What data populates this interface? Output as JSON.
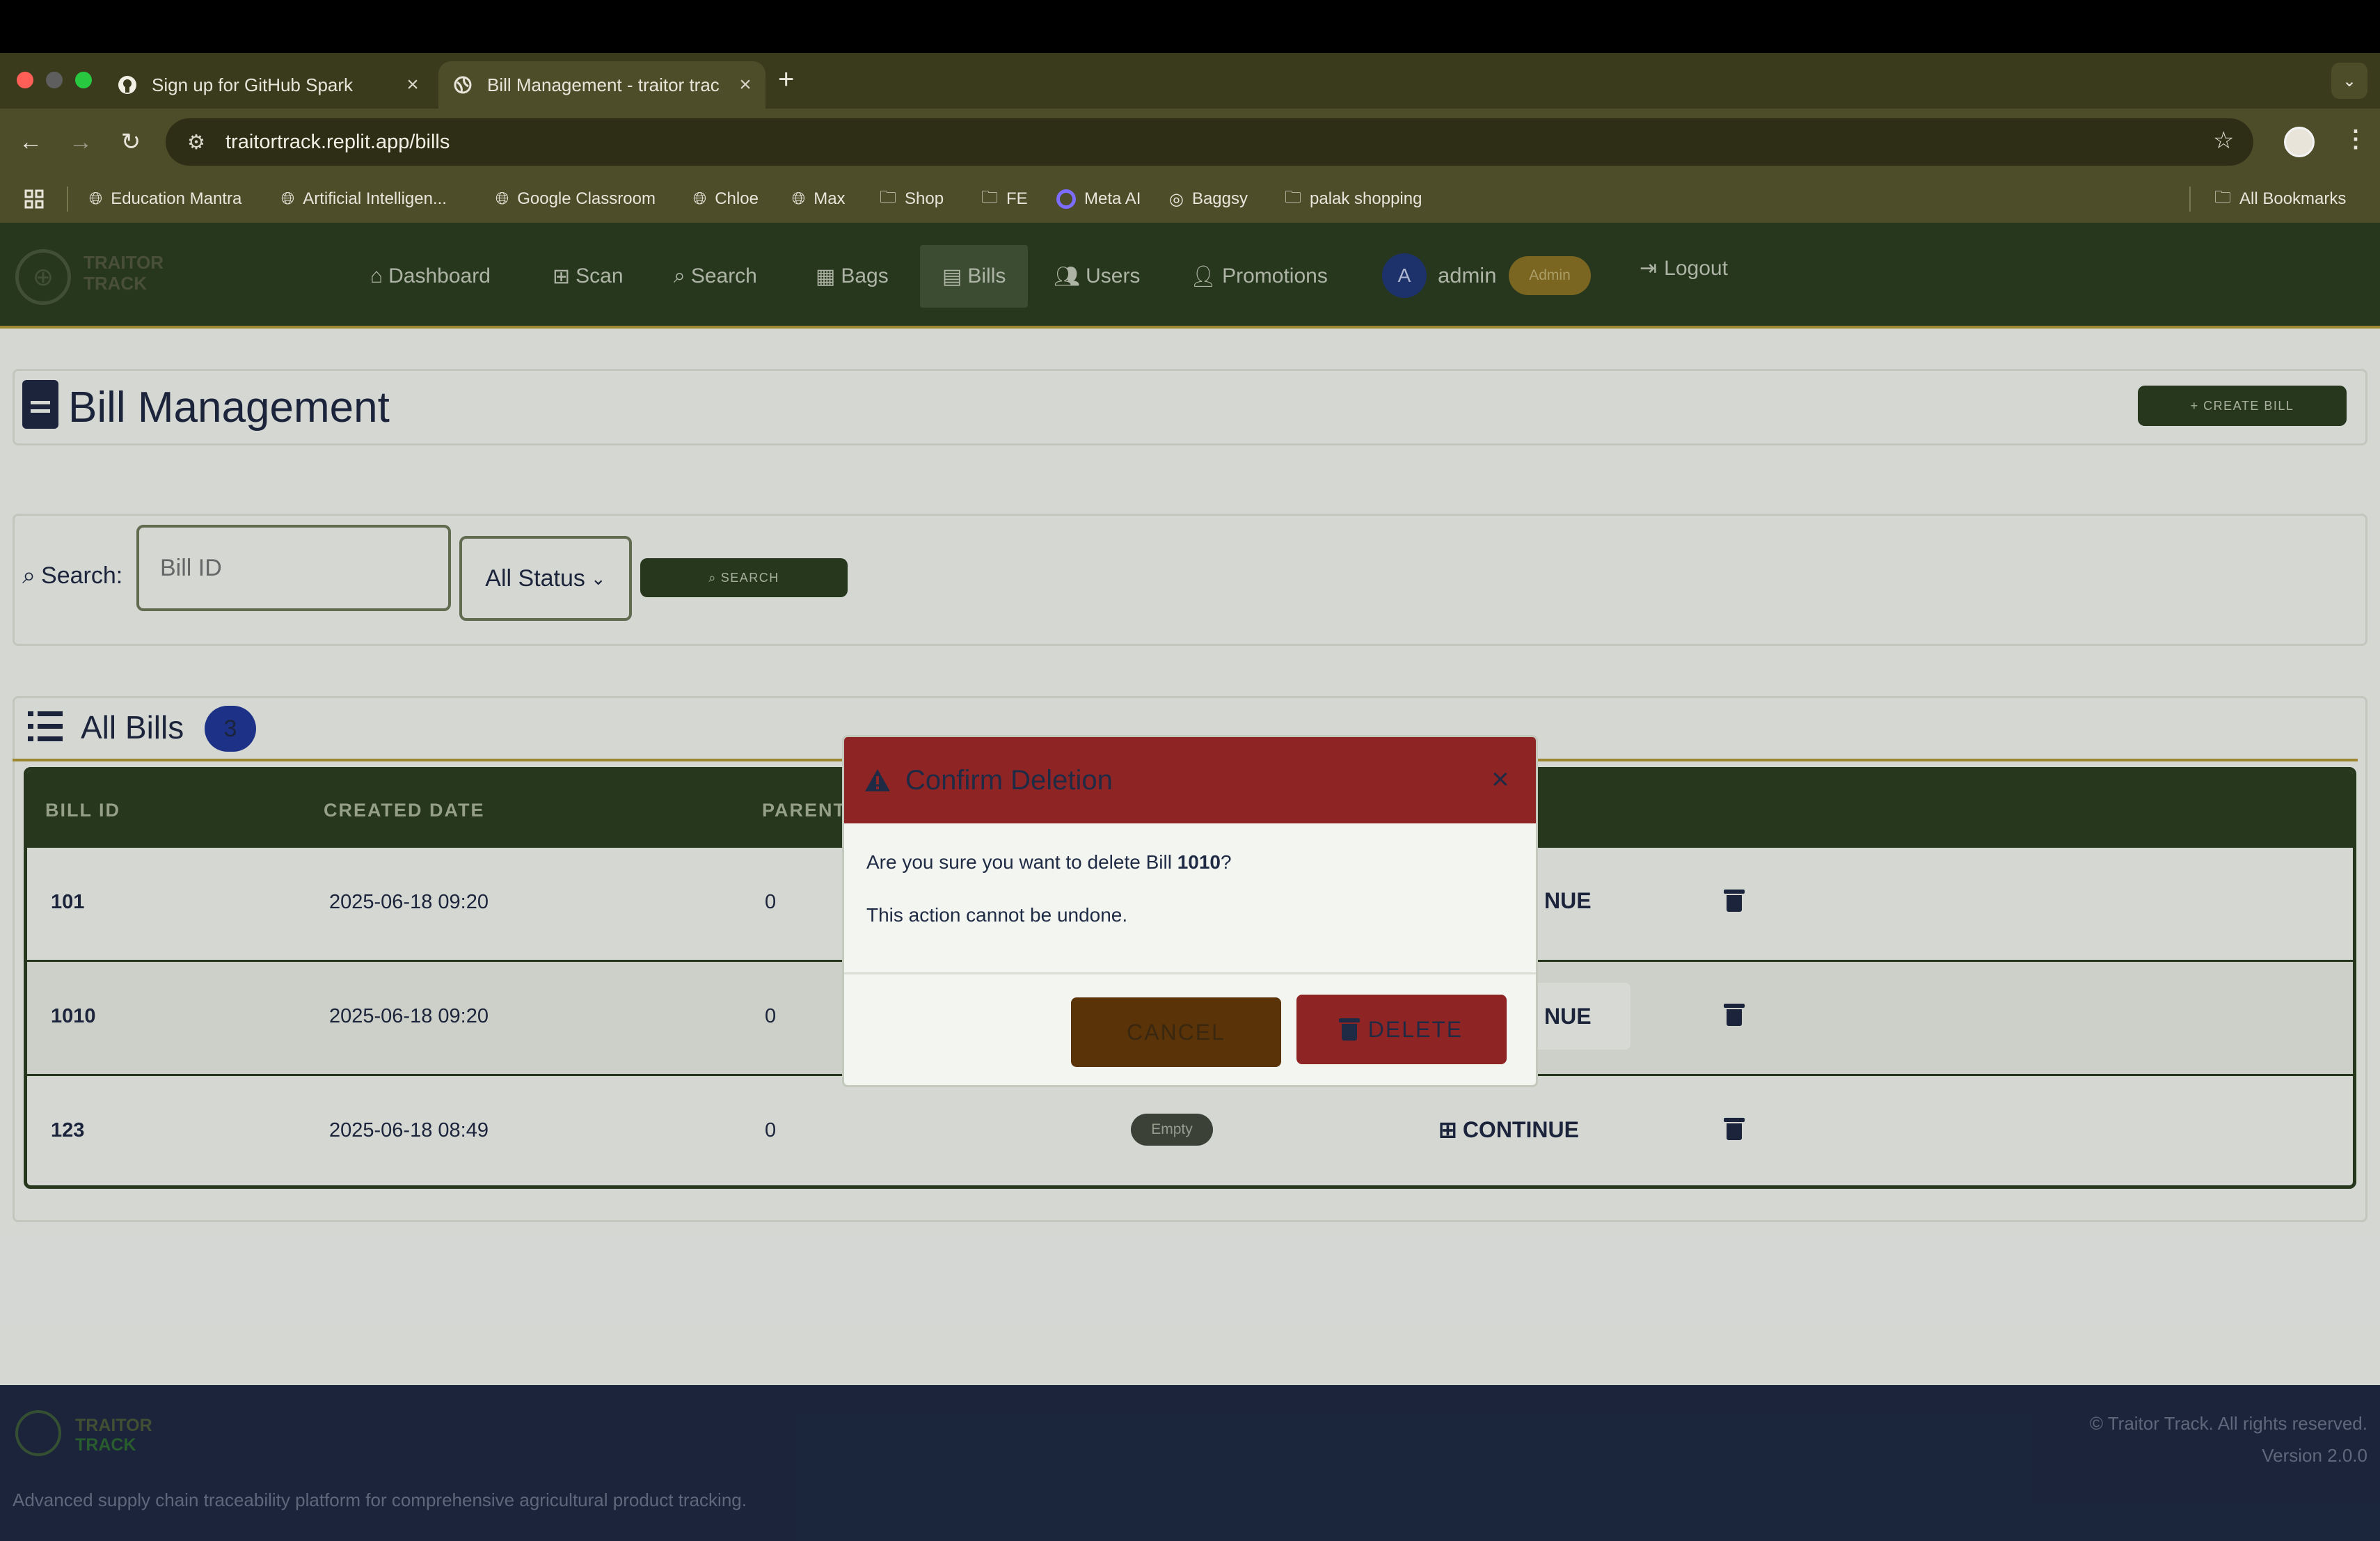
{
  "browser": {
    "tabs": [
      {
        "title": "Sign up for GitHub Spark",
        "icon": "github-icon",
        "active": false
      },
      {
        "title": "Bill Management - traitor trac",
        "icon": "globe-icon",
        "active": true
      }
    ],
    "url": "traitortrack.replit.app/bills",
    "bookmarks": [
      "Education Mantra",
      "Artificial Intelligen...",
      "Google Classroom",
      "Chloe",
      "Max",
      "Shop",
      "FE",
      "Meta AI",
      "Baggsy",
      "palak shopping"
    ],
    "all_bookmarks_label": "All Bookmarks"
  },
  "app": {
    "brand_line1": "TRAITOR",
    "brand_line2": "TRACK",
    "nav": {
      "dashboard": "Dashboard",
      "scan": "Scan",
      "search": "Search",
      "bags": "Bags",
      "bills": "Bills",
      "users": "Users",
      "promotions": "Promotions"
    },
    "user": {
      "initial": "A",
      "name": "admin",
      "role_badge": "Admin"
    },
    "logout": "Logout"
  },
  "page": {
    "title": "Bill Management",
    "create_bill": "+ CREATE BILL"
  },
  "search": {
    "label": "Search:",
    "placeholder": "Bill ID",
    "status_value": "All Status",
    "button": "SEARCH"
  },
  "bills": {
    "title": "All Bills",
    "count": "3",
    "columns": {
      "bill_id": "BILL ID",
      "created_date": "CREATED DATE",
      "parent": "PARENT"
    },
    "rows": [
      {
        "id": "101",
        "created": "2025-06-18 09:20",
        "parent": "0",
        "action": "NUE"
      },
      {
        "id": "1010",
        "created": "2025-06-18 09:20",
        "parent": "0",
        "action": "NUE"
      },
      {
        "id": "123",
        "created": "2025-06-18 08:49",
        "parent": "0",
        "status": "Empty",
        "action": "CONTINUE"
      }
    ]
  },
  "modal": {
    "title": "Confirm Deletion",
    "message_prefix": "Are you sure you want to delete Bill ",
    "bill_id": "1010",
    "message_suffix": "?",
    "note": "This action cannot be undone.",
    "cancel": "CANCEL",
    "delete": "DELETE"
  },
  "footer": {
    "brand_line1": "TRAITOR",
    "brand_line2": "TRACK",
    "tagline": "Advanced supply chain traceability platform for comprehensive agricultural product tracking.",
    "copyright": "© Traitor Track. All rights reserved.",
    "version": "Version 2.0.0"
  },
  "colors": {
    "header_green": "#2c3f22",
    "gold_accent": "#b59a3a",
    "danger_red": "#8f2424",
    "navy_text": "#1f2a44"
  }
}
